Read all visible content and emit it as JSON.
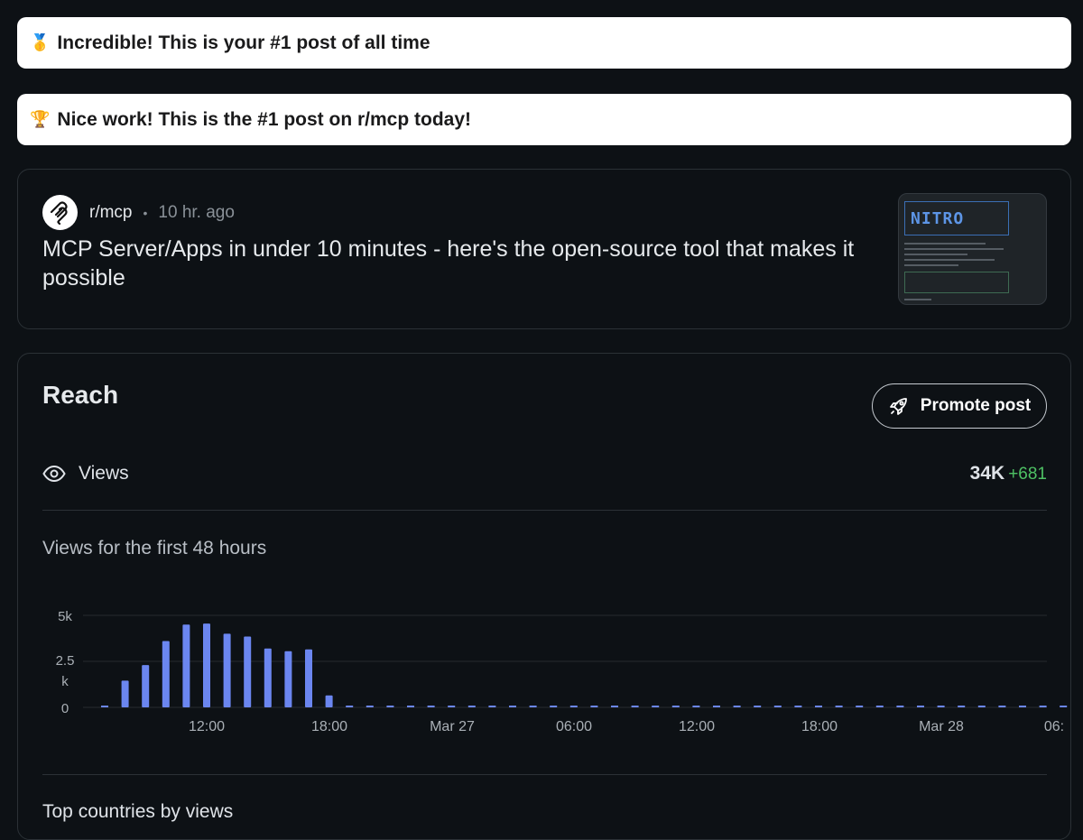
{
  "banners": [
    {
      "emoji": "🥇",
      "text": "Incredible! This is your #1 post of all time"
    },
    {
      "emoji": "🏆",
      "text": "Nice work! This is the #1 post on r/mcp today!"
    }
  ],
  "post": {
    "subreddit": "r/mcp",
    "separator": "•",
    "time": "10 hr. ago",
    "title": "MCP Server/Apps in under 10 minutes - here's the open-source tool that makes it possible",
    "thumbnail_text": "NITRO"
  },
  "reach": {
    "title": "Reach",
    "promote_label": "Promote post",
    "views_label": "Views",
    "views_count": "34K",
    "views_delta": "+681",
    "chart_subtitle": "Views for the first 48 hours",
    "countries_title": "Top countries by views"
  },
  "colors": {
    "bar": "#6b86f0",
    "delta": "#4ec164",
    "grid": "#262b30"
  },
  "chart_data": {
    "type": "bar",
    "title": "Views for the first 48 hours",
    "y_ticks": [
      "5k",
      "2.5 k",
      "0"
    ],
    "ylim": [
      0,
      5000
    ],
    "x_tick_labels": [
      "12:00",
      "18:00",
      "Mar 27",
      "06:00",
      "12:00",
      "18:00",
      "Mar 28",
      "06:"
    ],
    "values": [
      0,
      1450,
      2300,
      3600,
      4500,
      4550,
      4000,
      3850,
      3200,
      3050,
      3150,
      650,
      0,
      0,
      0,
      0,
      0,
      0,
      0,
      0,
      0,
      0,
      0,
      0,
      0,
      0,
      0,
      0,
      0,
      0,
      0,
      0,
      0,
      0,
      0,
      0,
      0,
      0,
      0,
      0,
      0,
      0,
      0,
      0,
      0,
      0,
      0,
      0
    ],
    "grid": true
  }
}
